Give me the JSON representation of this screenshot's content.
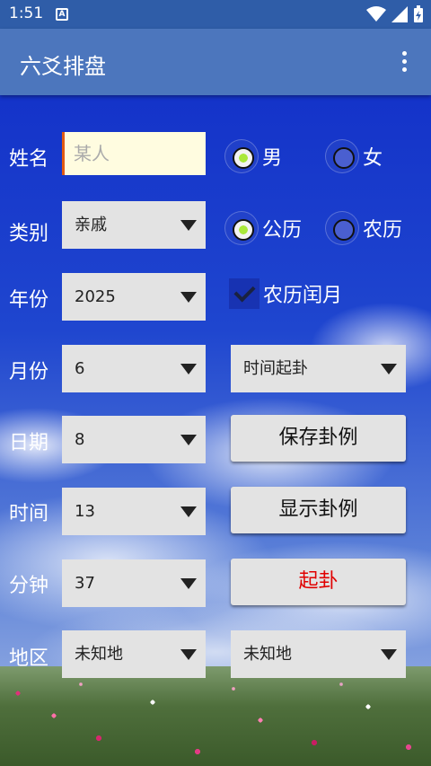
{
  "status_bar": {
    "time": "1:51",
    "notification_icon": "A"
  },
  "app_bar": {
    "title": "六爻排盘"
  },
  "labels": {
    "name": "姓名",
    "category": "类别",
    "year": "年份",
    "month": "月份",
    "day": "日期",
    "time": "时间",
    "minute": "分钟",
    "region": "地区"
  },
  "name_input": {
    "placeholder": "某人"
  },
  "gender": {
    "male": "男",
    "female": "女",
    "selected": "男"
  },
  "calendar": {
    "solar": "公历",
    "lunar": "农历",
    "selected": "公历"
  },
  "leap_month": {
    "label": "农历闰月",
    "checked": true
  },
  "fields": {
    "category": "亲戚",
    "year": "2025",
    "month": "6",
    "day": "8",
    "hour": "13",
    "minute": "37",
    "region": "未知地"
  },
  "method_select": "时间起卦",
  "region_select_2": "未知地",
  "buttons": {
    "save": "保存卦例",
    "show": "显示卦例",
    "divine": "起卦"
  },
  "colors": {
    "app_bar": "#4c76bd",
    "status_bar": "#2f5da8",
    "divine_text": "#e00000"
  }
}
